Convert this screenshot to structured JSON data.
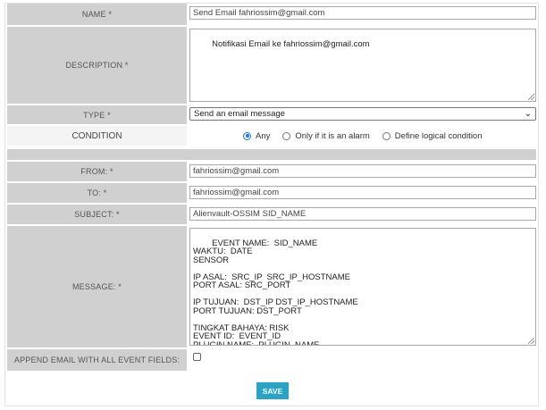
{
  "form": {
    "name": {
      "label": "NAME *",
      "value": "Send Email fahriossim@gmail.com"
    },
    "description": {
      "label": "DESCRIPTION *",
      "value": "Notifikasi Email ke fahriossim@gmail.com"
    },
    "type": {
      "label": "TYPE *",
      "value": "Send an email message"
    },
    "condition": {
      "label": "CONDITION",
      "options": [
        {
          "label": "Any",
          "selected": true
        },
        {
          "label": "Only if it is an alarm",
          "selected": false
        },
        {
          "label": "Define logical condition",
          "selected": false
        }
      ]
    },
    "from": {
      "label": "FROM: *",
      "value": "fahriossim@gmail.com"
    },
    "to": {
      "label": "TO: *",
      "value": "fahriossim@gmail.com"
    },
    "subject": {
      "label": "SUBJECT: *",
      "value": "Alienvault-OSSIM SID_NAME"
    },
    "message": {
      "label": "MESSAGE: *",
      "value": "EVENT NAME:  SID_NAME\nWAKTU:  DATE\nSENSOR\n\nIP ASAL:  SRC_IP  SRC_IP_HOSTNAME\nPORT ASAL: SRC_PORT\n\nIP TUJUAN:  DST_IP DST_IP_HOSTNAME\nPORT TUJUAN: DST_PORT\n\nTINGKAT BAHAYA: RISK\nEVENT ID:  EVENT_ID\nPLUGIN NAME:  PLUGIN_NAME"
    },
    "append": {
      "label": "APPEND EMAIL WITH ALL EVENT FIELDS:",
      "checked": false
    },
    "save_label": "SAVE"
  },
  "colors": {
    "label_bg": "#d0d0d0",
    "save_button": "#29a4c8",
    "radio_accent": "#1a73e8"
  }
}
